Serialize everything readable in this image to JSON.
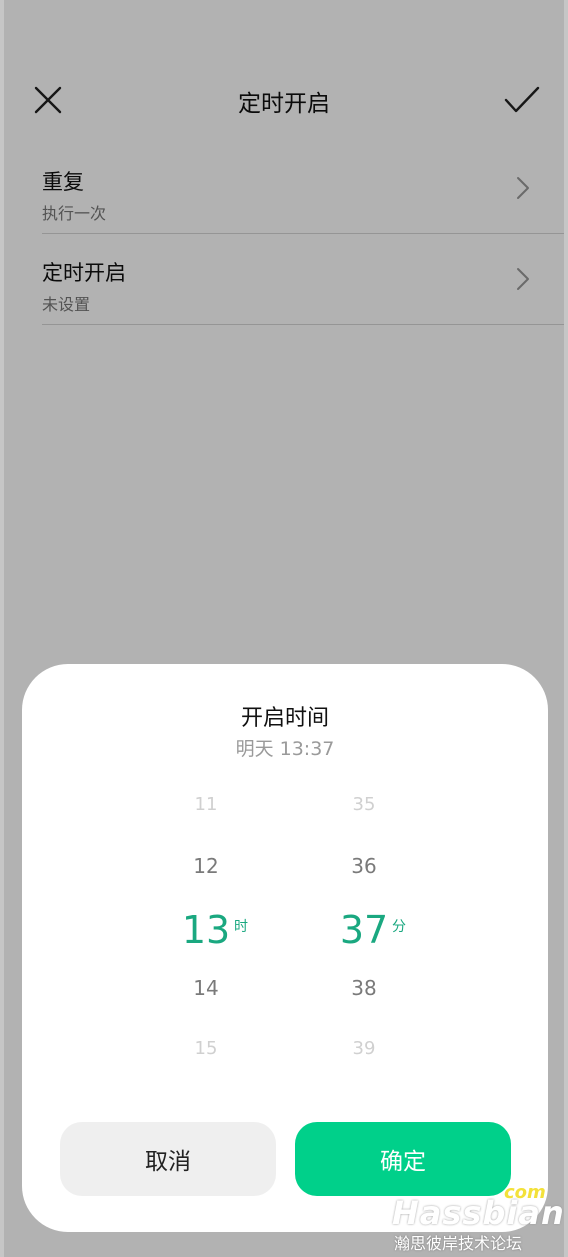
{
  "header": {
    "title": "定时开启"
  },
  "settings": [
    {
      "title": "重复",
      "subtitle": "执行一次"
    },
    {
      "title": "定时开启",
      "subtitle": "未设置"
    }
  ],
  "time_picker": {
    "title": "开启时间",
    "summary": "明天 13:37",
    "hours": {
      "items": [
        "11",
        "12",
        "13",
        "14",
        "15"
      ],
      "selected": "13",
      "unit": "时"
    },
    "minutes": {
      "items": [
        "35",
        "36",
        "37",
        "38",
        "39"
      ],
      "selected": "37",
      "unit": "分"
    },
    "cancel_label": "取消",
    "confirm_label": "确定"
  },
  "watermark": {
    "main": "Hassbian",
    "suffix": "com",
    "subtitle": "瀚思彼岸技术论坛"
  },
  "colors": {
    "accent": "#1aa880",
    "confirm_button": "#00d08a",
    "overlay": "#000000"
  },
  "icons": {
    "close": "close-icon",
    "confirm": "check-icon",
    "chevron": "chevron-right-icon"
  }
}
